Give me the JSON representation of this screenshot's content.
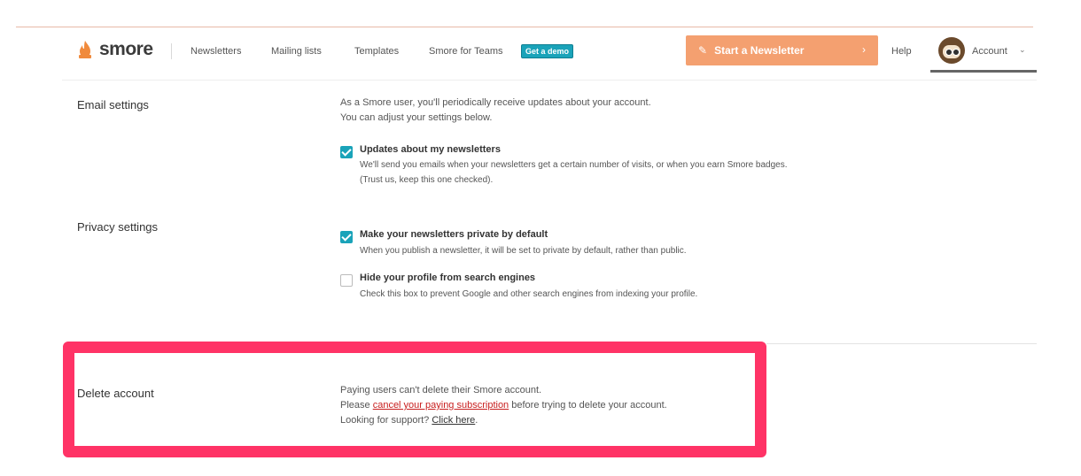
{
  "nav": {
    "logo_text": "smore",
    "links": [
      "Newsletters",
      "Mailing lists",
      "Templates",
      "Smore for Teams"
    ],
    "demo_badge": "Get a demo",
    "cta_label": "Start a Newsletter",
    "help": "Help",
    "account": "Account",
    "brand_color": "#f4a070",
    "accent_color": "#1aa3b9"
  },
  "email_settings": {
    "title": "Email settings",
    "intro": [
      "As a Smore user, you'll periodically receive updates about your account.",
      "You can adjust your settings below."
    ],
    "options": [
      {
        "title": "Updates about my newsletters",
        "checked": true,
        "desc": [
          "We'll send you emails when your newsletters get a certain number of visits, or when you earn Smore badges.",
          "(Trust us, keep this one checked)."
        ]
      }
    ]
  },
  "privacy_settings": {
    "title": "Privacy settings",
    "options": [
      {
        "title": "Make your newsletters private by default",
        "checked": true,
        "desc": "When you publish a newsletter, it will be set to private by default, rather than public."
      },
      {
        "title": "Hide your profile from search engines",
        "checked": false,
        "desc": "Check this box to prevent Google and other search engines from indexing your profile."
      }
    ]
  },
  "delete_account": {
    "title": "Delete account",
    "line1": "Paying users can't delete their Smore account.",
    "line2_pre": "Please ",
    "line2_link": "cancel your paying subscription",
    "line2_post": " before trying to delete your account.",
    "line3_pre": "Looking for support? ",
    "line3_link": "Click here",
    "line3_post": ".",
    "highlight_color": "#ff3366"
  }
}
